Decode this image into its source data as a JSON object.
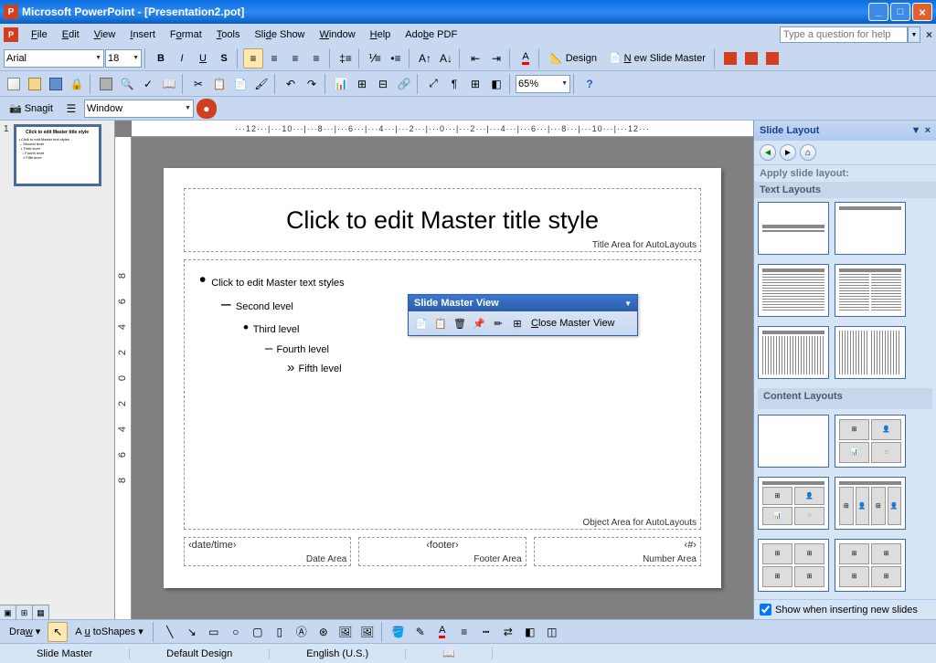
{
  "title": "Microsoft PowerPoint - [Presentation2.pot]",
  "menu": {
    "file": "File",
    "edit": "Edit",
    "view": "View",
    "insert": "Insert",
    "format": "Format",
    "tools": "Tools",
    "slideshow": "Slide Show",
    "window": "Window",
    "help": "Help",
    "adobepdf": "Adobe PDF"
  },
  "helpbox": {
    "placeholder": "Type a question for help"
  },
  "formatting": {
    "font": "Arial",
    "size": "18",
    "design": "Design",
    "newmaster": "New Slide Master"
  },
  "zoom": "65%",
  "snagit": {
    "label": "Snagit",
    "mode": "Window"
  },
  "ruler": {
    "h": "···12···|···10···|···8···|···6···|···4···|···2···|···0···|···2···|···4···|···6···|···8···|···10···|···12···",
    "v": [
      "8",
      "6",
      "4",
      "2",
      "0",
      "2",
      "4",
      "6",
      "8"
    ]
  },
  "thumb": {
    "num": "1",
    "title": "Click to edit Master title style"
  },
  "slide": {
    "title": "Click to edit Master title style",
    "title_area": "Title Area for AutoLayouts",
    "l1": "Click to edit Master text styles",
    "l2": "Second level",
    "l3": "Third level",
    "l4": "Fourth level",
    "l5": "Fifth level",
    "object_area": "Object Area for AutoLayouts",
    "date_ph": "‹date/time›",
    "date_label": "Date Area",
    "footer_ph": "‹footer›",
    "footer_label": "Footer Area",
    "num_ph": "‹#›",
    "num_label": "Number Area"
  },
  "smv": {
    "title": "Slide Master View",
    "close": "Close Master View"
  },
  "taskpane": {
    "title": "Slide Layout",
    "apply": "Apply slide layout:",
    "text_layouts": "Text Layouts",
    "content_layouts": "Content Layouts",
    "showcheck": "Show when inserting new slides"
  },
  "draw": {
    "draw": "Draw",
    "autoshapes": "AutoShapes"
  },
  "status": {
    "slidemaster": "Slide Master",
    "design": "Default Design",
    "lang": "English (U.S.)"
  }
}
